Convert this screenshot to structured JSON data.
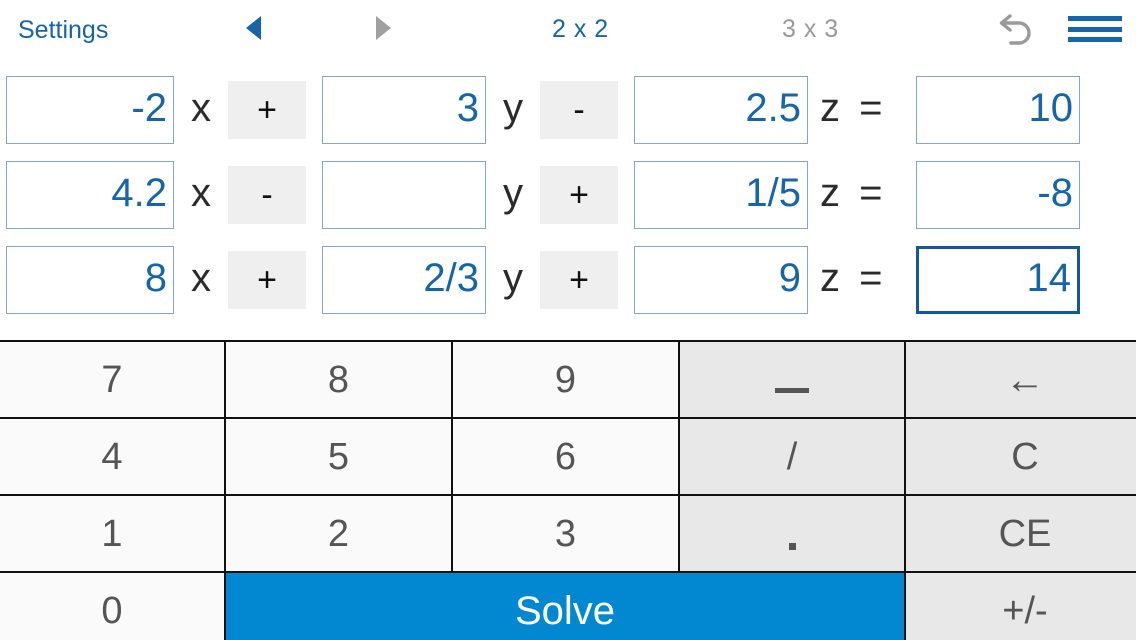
{
  "topbar": {
    "settings_label": "Settings",
    "prev_icon": "arrow-left-icon",
    "next_icon": "arrow-right-icon",
    "tab_2x2": "2 x 2",
    "tab_3x3": "3 x 3",
    "undo_icon": "undo-icon",
    "menu_icon": "hamburger-menu-icon",
    "accent_color": "#1565a8",
    "inactive_color": "#9a9a9a"
  },
  "equations": {
    "rows": [
      {
        "x_coef": "-2",
        "x_label": "x",
        "op1": "+",
        "y_coef": "3",
        "y_label": "y",
        "op2": "-",
        "z_coef": "2.5",
        "z_label": "z =",
        "result": "10",
        "focused": false
      },
      {
        "x_coef": "4.2",
        "x_label": "x",
        "op1": "-",
        "y_coef": "",
        "y_label": "y",
        "op2": "+",
        "z_coef": "1/5",
        "z_label": "z =",
        "result": "-8",
        "focused": false
      },
      {
        "x_coef": "8",
        "x_label": "x",
        "op1": "+",
        "y_coef": "2/3",
        "y_label": "y",
        "op2": "+",
        "z_coef": "9",
        "z_label": "z =",
        "result": "14",
        "focused": true
      }
    ],
    "input_border_color": "#7ea8cc",
    "focused_border_color": "#15569c",
    "value_color": "#1565a8",
    "operator_bg": "#efefef"
  },
  "keypad": {
    "keys": [
      {
        "label": "7",
        "name": "key-7",
        "type": "digit"
      },
      {
        "label": "8",
        "name": "key-8",
        "type": "digit"
      },
      {
        "label": "9",
        "name": "key-9",
        "type": "digit"
      },
      {
        "label": "_",
        "name": "key-underscore",
        "type": "fn"
      },
      {
        "label": "←",
        "name": "key-backspace",
        "type": "fn"
      },
      {
        "label": "4",
        "name": "key-4",
        "type": "digit"
      },
      {
        "label": "5",
        "name": "key-5",
        "type": "digit"
      },
      {
        "label": "6",
        "name": "key-6",
        "type": "digit"
      },
      {
        "label": "/",
        "name": "key-divide",
        "type": "fn"
      },
      {
        "label": "C",
        "name": "key-clear",
        "type": "fn"
      },
      {
        "label": "1",
        "name": "key-1",
        "type": "digit"
      },
      {
        "label": "2",
        "name": "key-2",
        "type": "digit"
      },
      {
        "label": "3",
        "name": "key-3",
        "type": "digit"
      },
      {
        "label": ".",
        "name": "key-decimal",
        "type": "fn"
      },
      {
        "label": "CE",
        "name": "key-clear-entry",
        "type": "fn"
      },
      {
        "label": "0",
        "name": "key-0",
        "type": "digit"
      },
      {
        "label": "Solve",
        "name": "solve-button",
        "type": "solve"
      },
      {
        "label": "+/-",
        "name": "key-sign-toggle",
        "type": "fn"
      }
    ],
    "solve_color": "#0288d1",
    "digit_bg": "#fafafa",
    "fn_bg": "#e8e8e8"
  }
}
